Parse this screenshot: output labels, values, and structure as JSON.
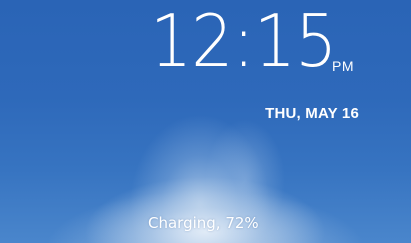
{
  "lockscreen": {
    "time": "12:15",
    "ampm": "PM",
    "date": "THU, MAY 16",
    "charging_status": "Charging, 72%"
  },
  "colors": {
    "background_top": "#2a64b6",
    "background_bottom": "#4a86cc",
    "text": "#ffffff"
  }
}
